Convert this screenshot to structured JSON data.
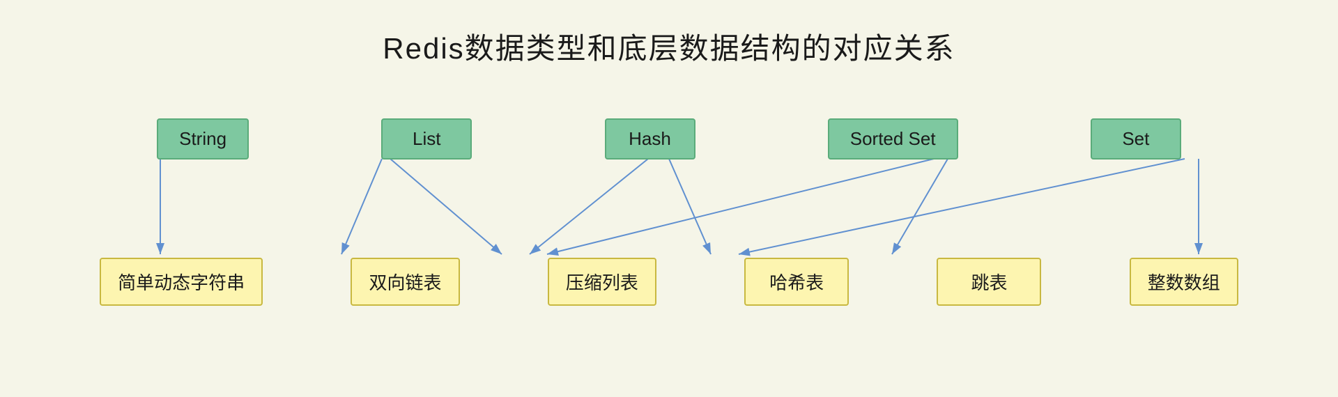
{
  "title": "Redis数据类型和底层数据结构的对应关系",
  "top_nodes": [
    {
      "id": "string",
      "label": "String"
    },
    {
      "id": "list",
      "label": "List"
    },
    {
      "id": "hash",
      "label": "Hash"
    },
    {
      "id": "sorted_set",
      "label": "Sorted Set"
    },
    {
      "id": "set",
      "label": "Set"
    }
  ],
  "bottom_nodes": [
    {
      "id": "sds",
      "label": "简单动态字符串"
    },
    {
      "id": "linkedlist",
      "label": "双向链表"
    },
    {
      "id": "ziplist",
      "label": "压缩列表"
    },
    {
      "id": "hashtable",
      "label": "哈希表"
    },
    {
      "id": "skiplist",
      "label": "跳表"
    },
    {
      "id": "intset",
      "label": "整数数组"
    }
  ],
  "arrows": [
    {
      "from": "string",
      "to": "sds"
    },
    {
      "from": "list",
      "to": "linkedlist"
    },
    {
      "from": "list",
      "to": "ziplist"
    },
    {
      "from": "hash",
      "to": "ziplist"
    },
    {
      "from": "hash",
      "to": "hashtable"
    },
    {
      "from": "sorted_set",
      "to": "skiplist"
    },
    {
      "from": "sorted_set",
      "to": "ziplist"
    },
    {
      "from": "set",
      "to": "hashtable"
    },
    {
      "from": "set",
      "to": "intset"
    }
  ]
}
